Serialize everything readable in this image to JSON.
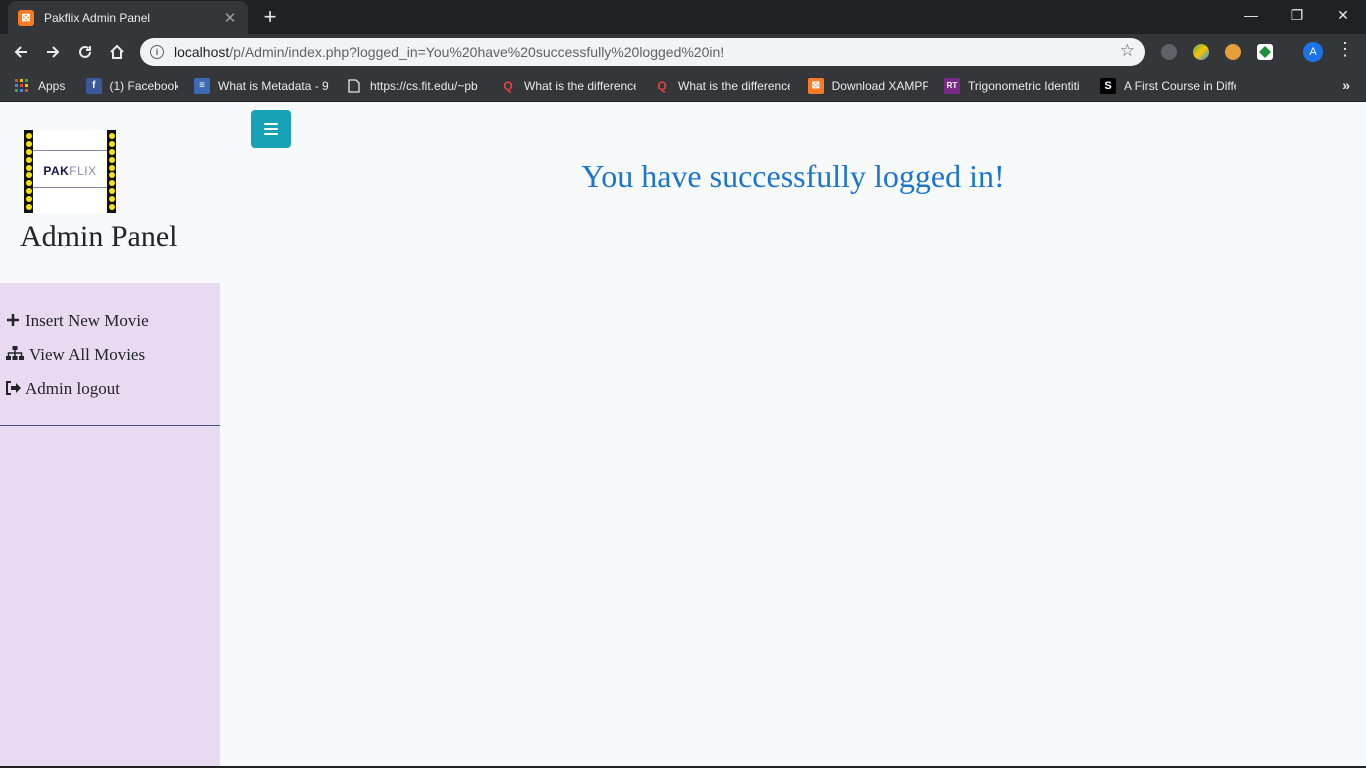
{
  "browser": {
    "tab_title": "Pakflix Admin Panel",
    "tab_close": "✕",
    "new_tab": "+",
    "url_host": "localhost",
    "url_path": "/p/Admin/index.php?logged_in=You%20have%20successfully%20logged%20in!",
    "profile_initial": "A",
    "window": {
      "minimize": "—",
      "maximize": "❐",
      "close": "✕"
    }
  },
  "bookmarks": [
    {
      "label": "Apps",
      "icon": "apps-grid-icon"
    },
    {
      "label": "(1) Facebook",
      "icon": "facebook-icon",
      "color": "#3b5998",
      "glyph": "f"
    },
    {
      "label": "What is Metadata - 9",
      "icon": "page-icon",
      "color": "#3b6bb5",
      "glyph": "≡"
    },
    {
      "label": "https://cs.fit.edu/~pb",
      "icon": "document-icon"
    },
    {
      "label": "What is the difference",
      "icon": "quora-icon",
      "color": "#b92b27",
      "glyph": "Q"
    },
    {
      "label": "What is the difference",
      "icon": "quora-icon",
      "color": "#b92b27",
      "glyph": "Q"
    },
    {
      "label": "Download XAMPP",
      "icon": "xampp-icon",
      "color": "#fb7a24",
      "glyph": "⊠"
    },
    {
      "label": "Trigonometric Identiti",
      "icon": "rapidtables-icon",
      "color": "#7b2a8a",
      "glyph": "RT"
    },
    {
      "label": "A First Course in Diffe",
      "icon": "scribd-icon",
      "color": "#000000",
      "glyph": "S"
    }
  ],
  "bookmarks_more": "»",
  "logo": {
    "text_bold": "PAK",
    "text_light": "FLIX"
  },
  "sidebar": {
    "title": "Admin Panel",
    "items": [
      {
        "label": "Insert New Movie",
        "icon": "plus-icon"
      },
      {
        "label": "View All Movies",
        "icon": "sitemap-icon"
      },
      {
        "label": "Admin logout",
        "icon": "sign-out-icon"
      }
    ]
  },
  "main": {
    "message": "You have successfully logged in!"
  },
  "colors": {
    "sidebar_bg": "#e8daf0",
    "toggle_btn": "#17a2b8",
    "message": "#1a75d2"
  }
}
